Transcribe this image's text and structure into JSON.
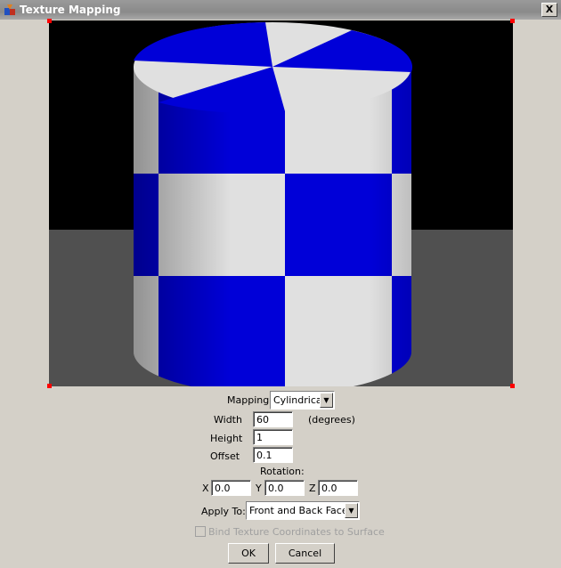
{
  "window": {
    "title": "Texture Mapping",
    "close": "X"
  },
  "form": {
    "mapping_label": "Mapping:",
    "mapping_value": "Cylindrical",
    "width_label": "Width",
    "width_value": "60",
    "width_unit": "(degrees)",
    "height_label": "Height",
    "height_value": "1",
    "offset_label": "Offset",
    "offset_value": "0.1",
    "rotation_label": "Rotation:",
    "rx_label": "X",
    "rx_value": "0.0",
    "ry_label": "Y",
    "ry_value": "0.0",
    "rz_label": "Z",
    "rz_value": "0.0",
    "apply_label": "Apply To:",
    "apply_value": "Front and Back Faces",
    "bind_label": "Bind Texture Coordinates to Surface",
    "ok": "OK",
    "cancel": "Cancel"
  },
  "colors": {
    "blue": "#0000d8",
    "white": "#e0e0e0",
    "floor": "#505050"
  }
}
